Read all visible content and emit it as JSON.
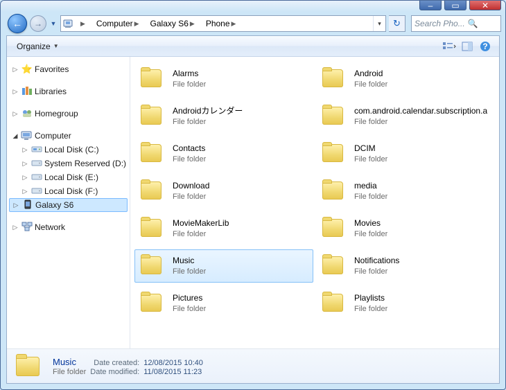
{
  "titlebar": {
    "min": "–",
    "max": "▭",
    "close": "✕"
  },
  "nav": {
    "crumbs": [
      "Computer",
      "Galaxy S6",
      "Phone"
    ],
    "search_placeholder": "Search Pho..."
  },
  "toolbar": {
    "organize": "Organize"
  },
  "tree": {
    "favorites": "Favorites",
    "libraries": "Libraries",
    "homegroup": "Homegroup",
    "computer": "Computer",
    "drives": [
      "Local Disk (C:)",
      "System Reserved (D:)",
      "Local Disk (E:)",
      "Local Disk (F:)",
      "Galaxy S6"
    ],
    "network": "Network"
  },
  "type_label": "File folder",
  "folders": [
    {
      "name": "Alarms"
    },
    {
      "name": "Android"
    },
    {
      "name": "Androidカレンダー"
    },
    {
      "name": "com.android.calendar.subscription.a"
    },
    {
      "name": "Contacts"
    },
    {
      "name": "DCIM"
    },
    {
      "name": "Download"
    },
    {
      "name": "media"
    },
    {
      "name": "MovieMakerLib"
    },
    {
      "name": "Movies"
    },
    {
      "name": "Music",
      "selected": true
    },
    {
      "name": "Notifications"
    },
    {
      "name": "Pictures"
    },
    {
      "name": "Playlists"
    }
  ],
  "details": {
    "name": "Music",
    "type": "File folder",
    "created_label": "Date created:",
    "created": "12/08/2015 10:40",
    "modified_label": "Date modified:",
    "modified": "11/08/2015 11:23"
  }
}
